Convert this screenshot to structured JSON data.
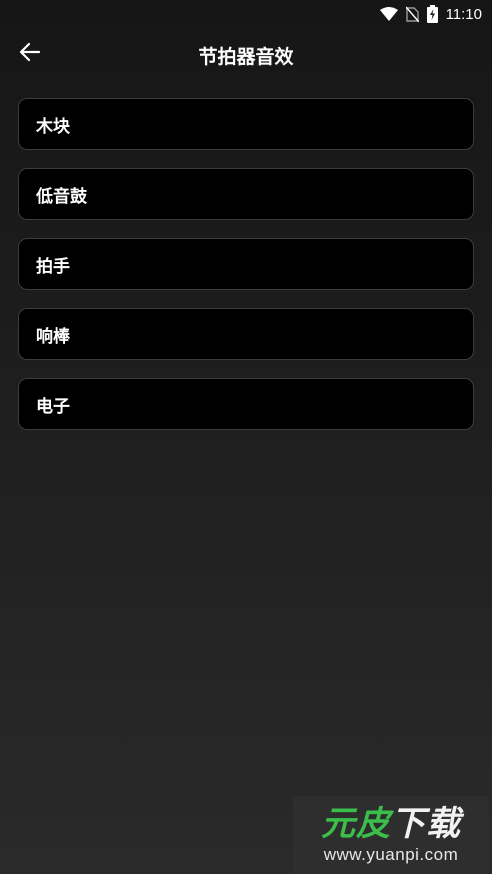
{
  "status_bar": {
    "time": "11:10",
    "icons": [
      "wifi-icon",
      "no-sim-icon",
      "battery-charging-icon"
    ]
  },
  "header": {
    "back_icon": "arrow-left-icon",
    "title": "节拍器音效"
  },
  "sound_options": [
    {
      "label": "木块"
    },
    {
      "label": "低音鼓"
    },
    {
      "label": "拍手"
    },
    {
      "label": "响棒"
    },
    {
      "label": "电子"
    }
  ],
  "watermark": {
    "logo_part1": "元皮",
    "logo_part2": "下载",
    "url": "www.yuanpi.com"
  },
  "colors": {
    "background": "#1d1d1d",
    "item_background": "#000000",
    "item_border": "#3c3c3c",
    "text": "#ffffff",
    "watermark_green": "#3bbf4a"
  }
}
